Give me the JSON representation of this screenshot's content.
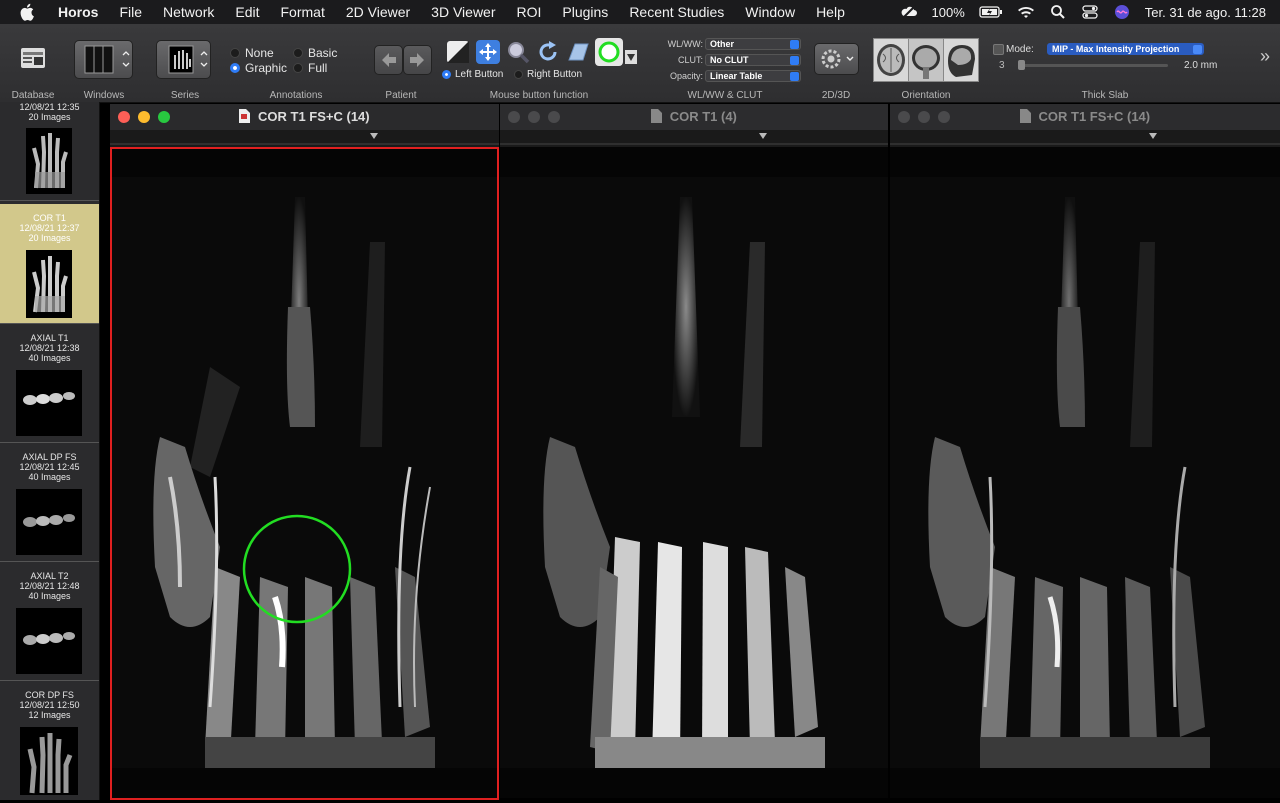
{
  "menubar": {
    "app": "Horos",
    "items": [
      "File",
      "Network",
      "Edit",
      "Format",
      "2D Viewer",
      "3D Viewer",
      "ROI",
      "Plugins",
      "Recent Studies",
      "Window",
      "Help"
    ],
    "battery": "100%",
    "datetime": "Ter. 31 de ago.  11:28"
  },
  "toolbar": {
    "labels": {
      "database": "Database",
      "windows": "Windows",
      "series": "Series",
      "annotations": "Annotations",
      "patient": "Patient",
      "mouse": "Mouse button function",
      "wlww_clut": "WL/WW & CLUT",
      "d2d3": "2D/3D",
      "orientation": "Orientation",
      "thick_slab": "Thick Slab"
    },
    "annotations": {
      "none": "None",
      "basic": "Basic",
      "graphic": "Graphic",
      "full": "Full",
      "selected": "Graphic"
    },
    "mouse_buttons": {
      "left": "Left Button",
      "right": "Right Button",
      "selected": "Left Button"
    },
    "wlww": {
      "label": "WL/WW:",
      "value": "Other"
    },
    "clut": {
      "label": "CLUT:",
      "value": "No CLUT"
    },
    "opacity": {
      "label": "Opacity:",
      "value": "Linear Table"
    },
    "thick": {
      "mode_label": "Mode:",
      "mode_value": "MIP - Max Intensity Projection",
      "slider_min": "3",
      "slider_value": "2.0 mm"
    },
    "overflow": "»"
  },
  "sidebar": {
    "series": [
      {
        "name": "",
        "date": "12/08/21 12:35",
        "count": "20 Images",
        "selected": false
      },
      {
        "name": "COR T1",
        "date": "12/08/21 12:37",
        "count": "20 Images",
        "selected": true
      },
      {
        "name": "AXIAL T1",
        "date": "12/08/21 12:38",
        "count": "40 Images",
        "selected": false
      },
      {
        "name": "AXIAL DP FS",
        "date": "12/08/21 12:45",
        "count": "40 Images",
        "selected": false
      },
      {
        "name": "AXIAL T2",
        "date": "12/08/21 12:48",
        "count": "40 Images",
        "selected": false
      },
      {
        "name": "COR DP FS",
        "date": "12/08/21 12:50",
        "count": "12 Images",
        "selected": false
      }
    ]
  },
  "viewers": [
    {
      "title": "COR T1 FS+C (14)",
      "active": true
    },
    {
      "title": "COR T1 (4)",
      "active": false
    },
    {
      "title": "COR T1 FS+C (14)",
      "active": false
    }
  ],
  "colors": {
    "accent": "#2f7cf6",
    "active_border": "#e02020",
    "roi_circle": "#22dd22",
    "selected_series": "#d2c88b"
  }
}
